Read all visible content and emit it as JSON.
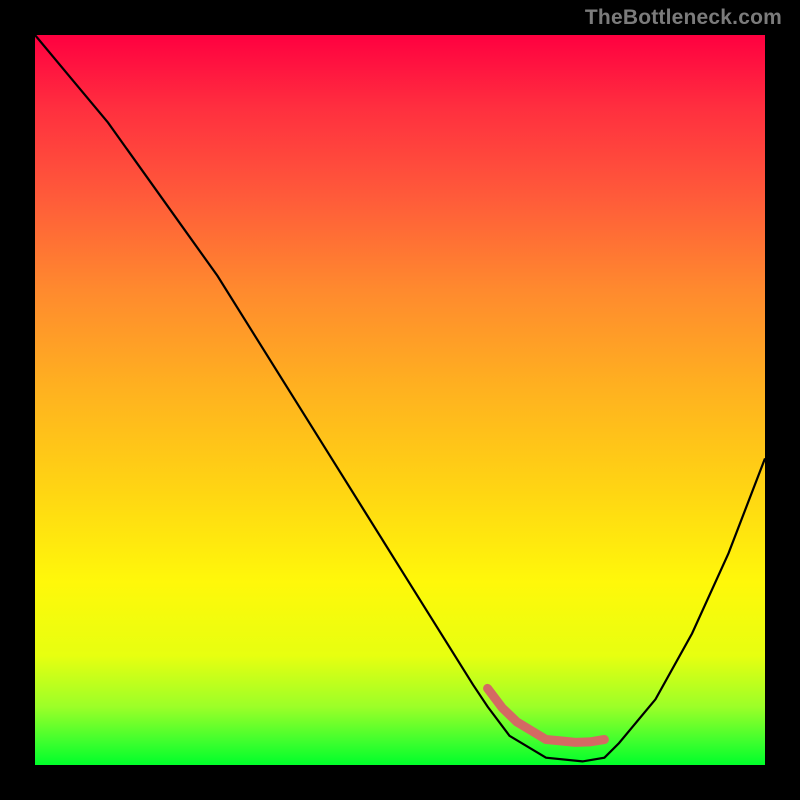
{
  "watermark": "TheBottleneck.com",
  "colors": {
    "page_bg": "#000000",
    "gradient_top": "#ff0040",
    "gradient_bottom": "#00ff2a",
    "curve": "#000000",
    "marker": "#d46a63",
    "watermark": "#7b7b7b"
  },
  "chart_data": {
    "type": "line",
    "title": "",
    "xlabel": "",
    "ylabel": "",
    "xlim": [
      0,
      100
    ],
    "ylim": [
      0,
      100
    ],
    "grid": false,
    "legend": false,
    "annotations": [
      "TheBottleneck.com"
    ],
    "series": [
      {
        "name": "curve",
        "color": "#000000",
        "x": [
          0,
          5,
          10,
          15,
          20,
          25,
          30,
          35,
          40,
          45,
          50,
          55,
          60,
          62,
          65,
          70,
          75,
          78,
          80,
          85,
          90,
          95,
          100
        ],
        "y": [
          100,
          94,
          88,
          81,
          74,
          67,
          59,
          51,
          43,
          35,
          27,
          19,
          11,
          8,
          4,
          1,
          0.5,
          1,
          3,
          9,
          18,
          29,
          42
        ]
      }
    ],
    "markers": [
      {
        "name": "optimal-range",
        "x_start": 62,
        "x_end": 78,
        "y_approx": 5,
        "color": "#d46a63"
      }
    ]
  }
}
